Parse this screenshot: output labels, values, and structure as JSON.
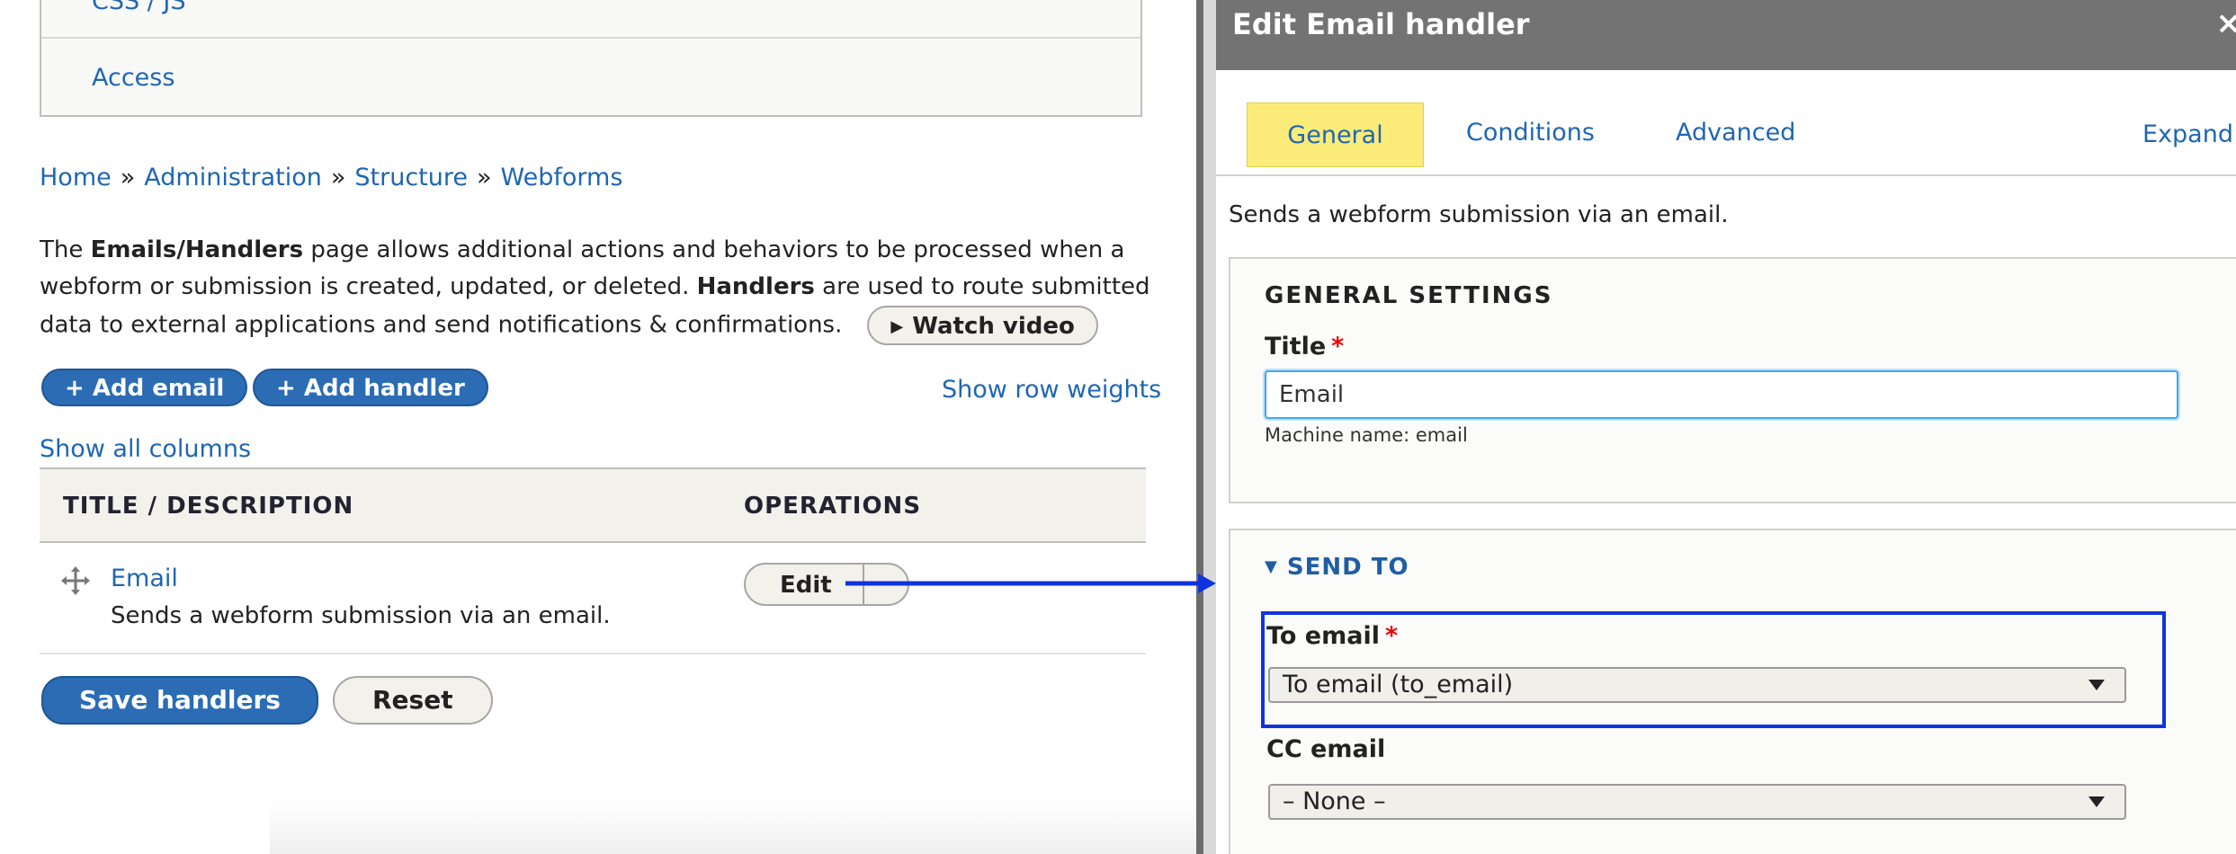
{
  "left": {
    "top_tabs": [
      "CSS / JS",
      "Access"
    ],
    "breadcrumb": [
      "Home",
      "Administration",
      "Structure",
      "Webforms"
    ],
    "breadcrumb_sep": "»",
    "description": {
      "p1": "The ",
      "b1": "Emails/Handlers",
      "p2": " page allows additional actions and behaviors to be processed when a webform or submission is created, updated, or deleted. ",
      "b2": "Handlers",
      "p3": " are used to route submitted data to external applications and send notifications & confirmations."
    },
    "watch_video": "Watch video",
    "add_email": "+ Add email",
    "add_handler": "+ Add handler",
    "show_row_weights": "Show row weights",
    "show_all_columns": "Show all columns",
    "table": {
      "headers": [
        "TITLE / DESCRIPTION",
        "OPERATIONS"
      ],
      "rows": [
        {
          "title": "Email",
          "description": "Sends a webform submission via an email.",
          "operation": "Edit"
        }
      ]
    },
    "save_handlers": "Save handlers",
    "reset": "Reset"
  },
  "dialog": {
    "title": "Edit Email handler",
    "close": "×",
    "tabs": [
      "General",
      "Conditions",
      "Advanced"
    ],
    "expand": "Expand",
    "description": "Sends a webform submission via an email.",
    "general_settings": {
      "legend": "GENERAL SETTINGS",
      "title_label": "Title",
      "title_value": "Email",
      "machine_name": "Machine name: email"
    },
    "send_to": {
      "legend": "SEND TO",
      "to_email_label": "To email",
      "to_email_value": "To email (to_email)",
      "cc_email_label": "CC email",
      "cc_email_value": "– None –"
    },
    "required_mark": "*"
  },
  "colors": {
    "link": "#1f66b3",
    "primary_button": "#2b6cb5",
    "active_tab": "#fbec7a",
    "dialog_header": "#737373",
    "highlight_box": "#1133dd",
    "required": "#e00000"
  }
}
